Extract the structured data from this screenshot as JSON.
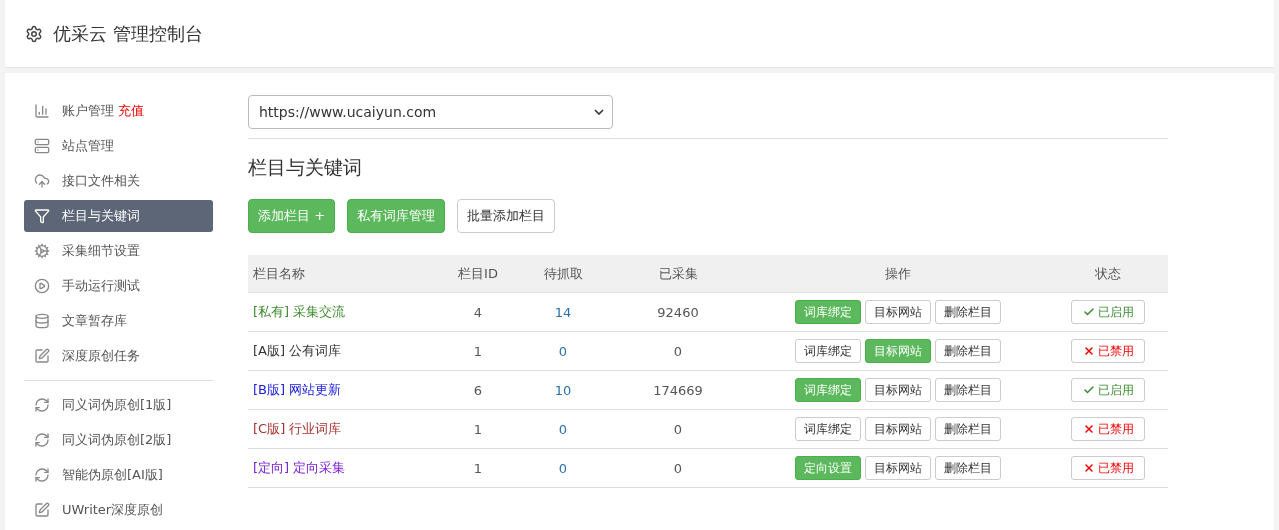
{
  "header": {
    "title": "优采云 管理控制台"
  },
  "sidebar": {
    "groups": [
      {
        "items": [
          {
            "kind": "chart",
            "label": "账户管理",
            "badge": "充值",
            "selected": false
          },
          {
            "kind": "server",
            "label": "站点管理",
            "selected": false
          },
          {
            "kind": "cloud",
            "label": "接口文件相关",
            "selected": false
          },
          {
            "kind": "filter",
            "label": "栏目与关键词",
            "selected": true
          },
          {
            "kind": "cogs",
            "label": "采集细节设置",
            "selected": false
          },
          {
            "kind": "play",
            "label": "手动运行测试",
            "selected": false
          },
          {
            "kind": "database",
            "label": "文章暂存库",
            "selected": false
          },
          {
            "kind": "edit",
            "label": "深度原创任务",
            "selected": false
          }
        ]
      },
      {
        "items": [
          {
            "kind": "refresh",
            "label": "同义词伪原创[1版]",
            "selected": false
          },
          {
            "kind": "refresh",
            "label": "同义词伪原创[2版]",
            "selected": false
          },
          {
            "kind": "refresh",
            "label": "智能伪原创[AI版]",
            "selected": false
          },
          {
            "kind": "edit",
            "label": "UWriter深度原创",
            "selected": false
          }
        ]
      }
    ]
  },
  "site_select": {
    "value": "https://www.ucaiyun.com"
  },
  "section_title": "栏目与关键词",
  "toolbar": [
    {
      "label": "添加栏目 +",
      "kind": "primary"
    },
    {
      "label": "私有词库管理",
      "kind": "primary"
    },
    {
      "label": "批量添加栏目",
      "kind": "default"
    }
  ],
  "table": {
    "columns": [
      "栏目名称",
      "栏目ID",
      "待抓取",
      "已采集",
      "操作",
      "状态"
    ],
    "rows": [
      {
        "tag": "[私有]",
        "name": "采集交流",
        "color": "#3c8a2e",
        "id": "4",
        "pending": "14",
        "collected": "92460",
        "actions": [
          {
            "label": "词库绑定",
            "primary": true
          },
          {
            "label": "目标网站",
            "primary": false
          },
          {
            "label": "删除栏目",
            "primary": false
          }
        ],
        "status": {
          "label": "已启用",
          "enabled": true
        }
      },
      {
        "tag": "[A版]",
        "name": "公有词库",
        "color": "#333333",
        "id": "1",
        "pending": "0",
        "collected": "0",
        "actions": [
          {
            "label": "词库绑定",
            "primary": false
          },
          {
            "label": "目标网站",
            "primary": true
          },
          {
            "label": "删除栏目",
            "primary": false
          }
        ],
        "status": {
          "label": "已禁用",
          "enabled": false
        }
      },
      {
        "tag": "[B版]",
        "name": "网站更新",
        "color": "#1a1adb",
        "id": "6",
        "pending": "10",
        "collected": "174669",
        "actions": [
          {
            "label": "词库绑定",
            "primary": true
          },
          {
            "label": "目标网站",
            "primary": false
          },
          {
            "label": "删除栏目",
            "primary": false
          }
        ],
        "status": {
          "label": "已启用",
          "enabled": true
        }
      },
      {
        "tag": "[C版]",
        "name": "行业词库",
        "color": "#a5322f",
        "id": "1",
        "pending": "0",
        "collected": "0",
        "actions": [
          {
            "label": "词库绑定",
            "primary": false
          },
          {
            "label": "目标网站",
            "primary": false
          },
          {
            "label": "删除栏目",
            "primary": false
          }
        ],
        "status": {
          "label": "已禁用",
          "enabled": false
        }
      },
      {
        "tag": "[定向]",
        "name": "定向采集",
        "color": "#7a1fd6",
        "id": "1",
        "pending": "0",
        "collected": "0",
        "actions": [
          {
            "label": "定向设置",
            "primary": true
          },
          {
            "label": "目标网站",
            "primary": false
          },
          {
            "label": "删除栏目",
            "primary": false
          }
        ],
        "status": {
          "label": "已禁用",
          "enabled": false
        }
      }
    ]
  }
}
